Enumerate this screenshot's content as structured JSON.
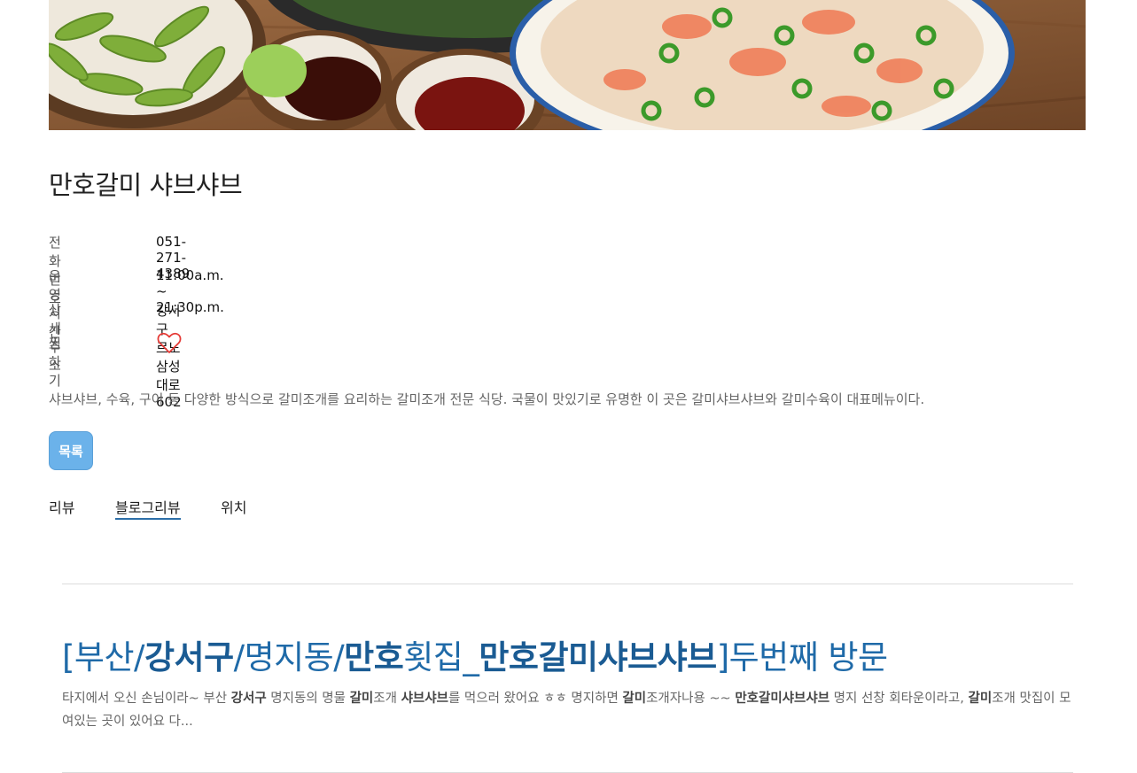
{
  "restaurant": {
    "name": "만호갈미 샤브샤브",
    "fields": [
      {
        "label": "전화번호",
        "value": "051-271-4389"
      },
      {
        "label": "운영시간",
        "value": "11:00a.m. ~ 21:30p.m."
      },
      {
        "label": "상세주소",
        "value": "강서구 르노삼성대로 602"
      }
    ],
    "favorite_label": "찜하기",
    "description": "샤브샤브, 수육, 구이 등 다양한 방식으로 갈미조개를 요리하는 갈미조개 전문 식당. 국물이 맛있기로 유명한 이 곳은 갈미샤브샤브와 갈미수육이 대표메뉴이다."
  },
  "list_button": "목록",
  "tabs": [
    {
      "label": "리뷰",
      "active": false
    },
    {
      "label": "블로그리뷰",
      "active": true
    },
    {
      "label": "위치",
      "active": false
    }
  ],
  "blog_post": {
    "title_parts": [
      {
        "text": "[부산/",
        "bold": false
      },
      {
        "text": "강서구",
        "bold": true
      },
      {
        "text": "/명지동/",
        "bold": false
      },
      {
        "text": "만호",
        "bold": true
      },
      {
        "text": "횟집_",
        "bold": false
      },
      {
        "text": "만호갈미샤브샤브",
        "bold": true
      },
      {
        "text": "]두번째 방문",
        "bold": false
      }
    ],
    "excerpt_parts": [
      {
        "text": "타지에서 오신 손님이라~ 부산 ",
        "bold": false
      },
      {
        "text": "강서구",
        "bold": true
      },
      {
        "text": " 명지동의 명물 ",
        "bold": false
      },
      {
        "text": "갈미",
        "bold": true
      },
      {
        "text": "조개 ",
        "bold": false
      },
      {
        "text": "샤브샤브",
        "bold": true
      },
      {
        "text": "를 먹으러 왔어요 ㅎㅎ 명지하면 ",
        "bold": false
      },
      {
        "text": "갈미",
        "bold": true
      },
      {
        "text": "조개자나용 ~~ ",
        "bold": false
      },
      {
        "text": "만호갈미샤브샤브",
        "bold": true
      },
      {
        "text": " 명지 선창 회타운이라고, ",
        "bold": false
      },
      {
        "text": "갈미",
        "bold": true
      },
      {
        "text": "조개 맛집이 모여있는 곳이 있어요 다...",
        "bold": false
      }
    ]
  },
  "colors": {
    "button": "#6bb2ea",
    "link": "#1f6aa8",
    "heart": "#e53935",
    "tab_underline": "#2d6fa8"
  },
  "icons": {
    "favorite": "heart-outline-icon"
  }
}
